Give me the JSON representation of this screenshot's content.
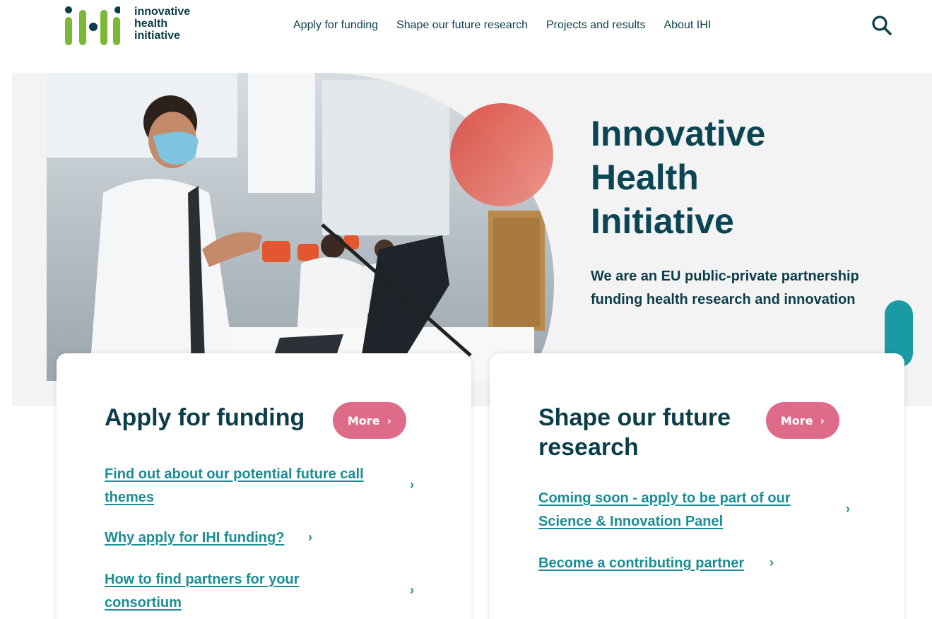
{
  "logo": {
    "line1": "innovative",
    "line2": "health",
    "line3": "initiative",
    "colors": {
      "green": "#7ab835",
      "navy": "#0b3d4a"
    }
  },
  "nav": {
    "items": [
      {
        "label": "Apply for funding"
      },
      {
        "label": "Shape our future research"
      },
      {
        "label": "Projects and results"
      },
      {
        "label": "About IHI"
      }
    ],
    "search_icon": "search-icon"
  },
  "hero": {
    "title": "Innovative Health Initiative",
    "subtitle": "We are an EU public-private partnership funding health research and innovation"
  },
  "cards": [
    {
      "title": "Apply for funding",
      "more_label": "More",
      "links": [
        {
          "label": "Find out about our potential future call themes"
        },
        {
          "label": "Why apply for IHI funding?"
        },
        {
          "label": "How to find partners for your consortium"
        }
      ]
    },
    {
      "title": "Shape our future research",
      "more_label": "More",
      "links": [
        {
          "label": "Coming soon - apply to be part of our Science & Innovation Panel"
        },
        {
          "label": "Become a contributing partner"
        }
      ]
    }
  ],
  "colors": {
    "navy": "#0b3d4a",
    "teal": "#1a8d96",
    "pink": "#de6b8a",
    "hero_bg": "#f3f3f3"
  }
}
